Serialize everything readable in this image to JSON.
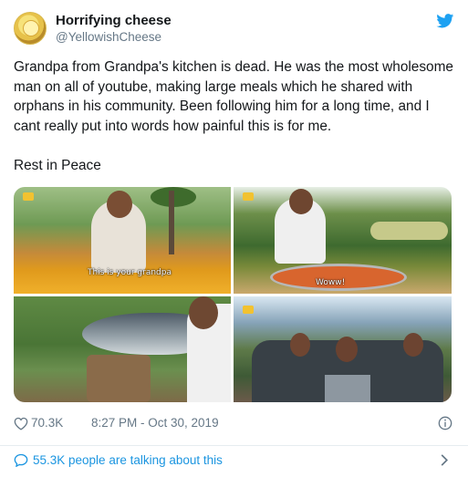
{
  "author": {
    "name": "Horrifying cheese",
    "handle": "@YellowishCheese"
  },
  "tweet": {
    "body": "Grandpa from Grandpa's kitchen is dead. He was the most wholesome man on all of youtube, making large meals which he shared with orphans in his community. Been following him for a long time, and I cant really put into words how painful this is for me.",
    "closing": "Rest in Peace"
  },
  "media": {
    "photo1_caption": "This is your grandpa",
    "photo2_caption": "Woww!"
  },
  "meta": {
    "likes": "70.3K",
    "timestamp": "8:27 PM - Oct 30, 2019"
  },
  "conversation": {
    "label": "55.3K people are talking about this"
  },
  "colors": {
    "accent": "#1b95e0",
    "twitter_blue": "#1da1f2",
    "secondary_text": "#657786",
    "primary_text": "#14171a",
    "divider": "#e6ecf0"
  },
  "icons": {
    "brand": "twitter-bird-icon",
    "like": "heart-icon",
    "info": "info-icon",
    "conversation": "speech-bubble-icon",
    "chevron": "chevron-right-icon"
  }
}
